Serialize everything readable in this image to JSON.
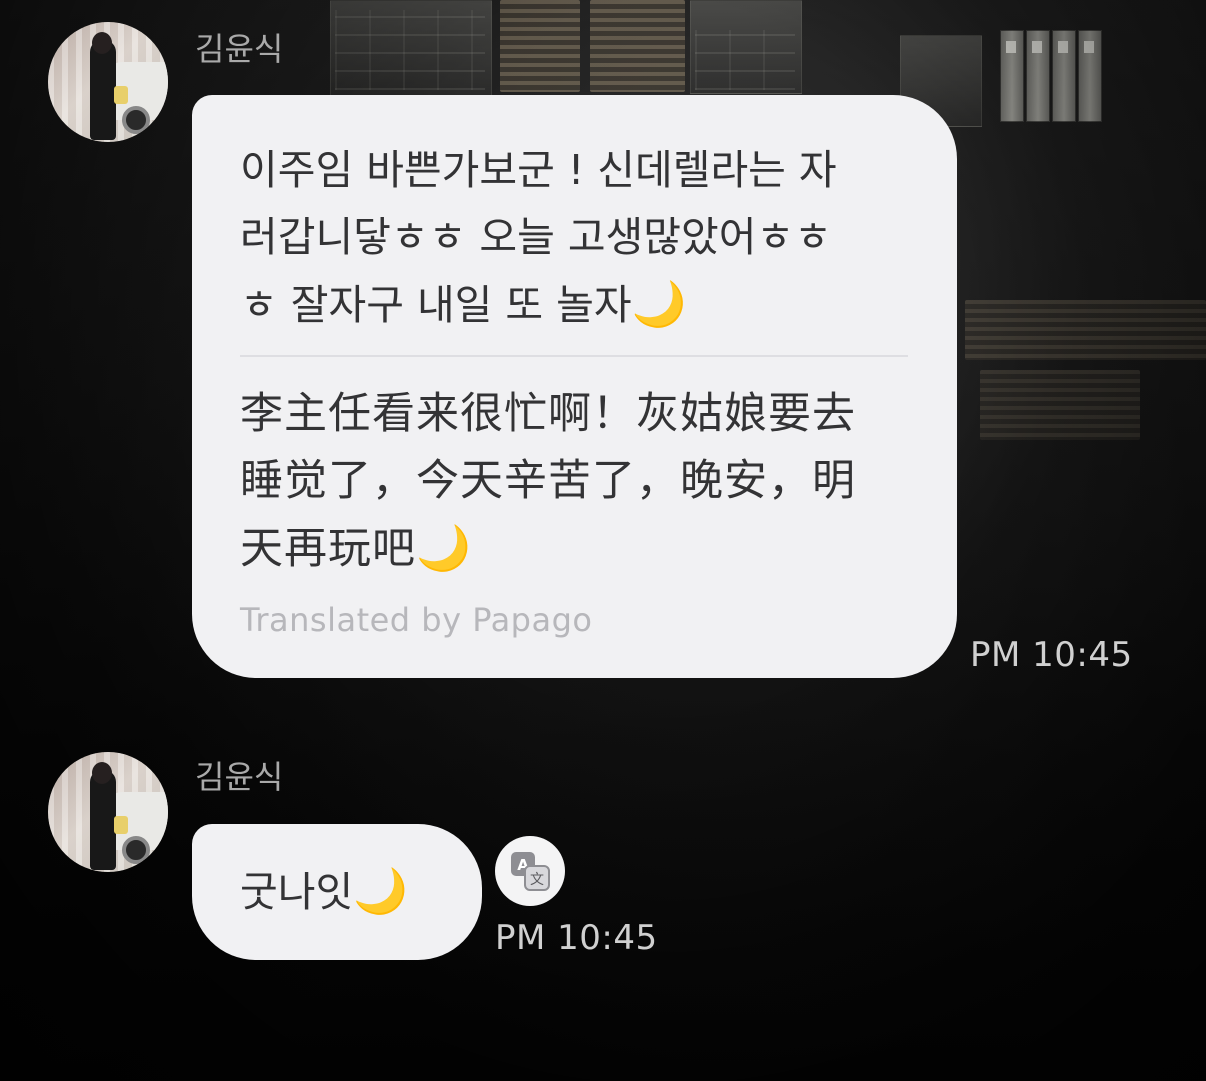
{
  "messages": [
    {
      "sender": "김윤식",
      "text": "이주임 바쁜가보군 ! 신데렐라는 자\n러갑니닿ㅎㅎ 오늘 고생많았어ㅎㅎ\nㅎ 잘자구 내일 또 놀자",
      "text_emoji": "🌙",
      "translation": "李主任看来很忙啊！灰姑娘要去\n睡觉了，今天辛苦了，晚安，明\n天再玩吧",
      "translation_emoji": "🌙",
      "translated_by": "Translated by Papago",
      "time": "PM 10:45"
    },
    {
      "sender": "김윤식",
      "text": "굿나잇",
      "text_emoji": "🌙",
      "time": "PM 10:45",
      "translate_icon": "translate-icon"
    }
  ],
  "colors": {
    "bubble": "#f1f1f3",
    "text": "#333335",
    "sender": "#a9a9a9",
    "time": "#d0d0d0",
    "translated_by": "#b7b7bb",
    "moon": "#f3c94a"
  }
}
